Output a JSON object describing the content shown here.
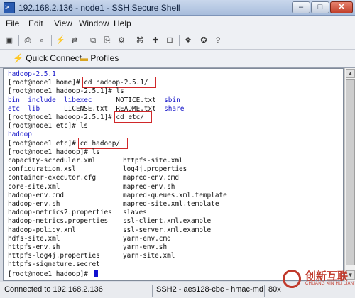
{
  "window": {
    "title": "192.168.2.136 - node1 - SSH Secure Shell",
    "min": "–",
    "max": "□",
    "close": "✕",
    "app_icon": "terminal-icon"
  },
  "menu": [
    "File",
    "Edit",
    "View",
    "Window",
    "Help"
  ],
  "toolbar": {
    "icons": [
      "save-icon",
      "print-icon",
      "find-icon",
      "quick-connect-icon",
      "file-transfer-icon",
      "copy-icon",
      "paste-icon",
      "settings-icon",
      "binoculars-icon",
      "new-file-icon",
      "open-folder-icon",
      "profile-icon",
      "help-icon",
      "whats-this-icon"
    ],
    "glyphs": [
      "▣",
      "⎙",
      "⌕",
      "⚡",
      "⇄",
      "⧉",
      "⎘",
      "⚙",
      "⌘",
      "✚",
      "⊟",
      "❖",
      "✪",
      "?"
    ]
  },
  "quickbar": {
    "quick_connect": "Quick Connect",
    "profiles": "Profiles"
  },
  "terminal": {
    "lines": [
      {
        "kind": "blue",
        "text": "hadoop-2.5.1"
      },
      {
        "kind": "prompt",
        "prompt": "[root@node1 home]# ",
        "cmd": "cd hadoop-2.5.1/"
      },
      {
        "kind": "text",
        "text": "[root@node1 hadoop-2.5.1]# ls"
      },
      {
        "kind": "mixed",
        "parts": [
          {
            "text": "bin  include  libexec      ",
            "blue": true
          },
          {
            "text": "NOTICE.txt  ",
            "blue": false
          },
          {
            "text": "sbin",
            "blue": true
          }
        ]
      },
      {
        "kind": "mixed",
        "parts": [
          {
            "text": "etc  lib      ",
            "blue": true
          },
          {
            "text": "LICENSE.txt  README.txt  ",
            "blue": false
          },
          {
            "text": "share",
            "blue": true
          }
        ]
      },
      {
        "kind": "prompt",
        "prompt": "[root@node1 hadoop-2.5.1]# ",
        "cmd": "cd etc/"
      },
      {
        "kind": "text",
        "text": "[root@node1 etc]# ls"
      },
      {
        "kind": "blue",
        "text": "hadoop"
      },
      {
        "kind": "prompt",
        "prompt": "[root@node1 etc]# ",
        "cmd": "cd hadoop/"
      },
      {
        "kind": "text",
        "text": "[root@node1 hadoop]# ls"
      },
      {
        "kind": "cols",
        "a": "capacity-scheduler.xml",
        "b": "httpfs-site.xml"
      },
      {
        "kind": "cols",
        "a": "configuration.xsl",
        "b": "log4j.properties"
      },
      {
        "kind": "cols",
        "a": "container-executor.cfg",
        "b": "mapred-env.cmd"
      },
      {
        "kind": "cols",
        "a": "core-site.xml",
        "b": "mapred-env.sh"
      },
      {
        "kind": "cols",
        "a": "hadoop-env.cmd",
        "b": "mapred-queues.xml.template"
      },
      {
        "kind": "cols",
        "a": "hadoop-env.sh",
        "b": "mapred-site.xml.template"
      },
      {
        "kind": "cols",
        "a": "hadoop-metrics2.properties",
        "b": "slaves"
      },
      {
        "kind": "cols",
        "a": "hadoop-metrics.properties",
        "b": "ssl-client.xml.example"
      },
      {
        "kind": "cols",
        "a": "hadoop-policy.xml",
        "b": "ssl-server.xml.example"
      },
      {
        "kind": "cols",
        "a": "hdfs-site.xml",
        "b": "yarn-env.cmd"
      },
      {
        "kind": "cols",
        "a": "httpfs-env.sh",
        "b": "yarn-env.sh"
      },
      {
        "kind": "cols",
        "a": "httpfs-log4j.properties",
        "b": "yarn-site.xml"
      },
      {
        "kind": "text",
        "text": "httpfs-signature.secret"
      },
      {
        "kind": "cursor",
        "text": "[root@node1 hadoop]# "
      }
    ]
  },
  "statusbar": {
    "connected": "Connected to 192.168.2.136",
    "cipher": "SSH2 - aes128-cbc - hmac-md5",
    "size": "80x"
  },
  "watermark": {
    "brand": "创新互联",
    "sub": "CHUANG XIN HU LIAN"
  },
  "colors": {
    "dir_blue": "#1414c8",
    "highlight_red": "#d0282a"
  }
}
